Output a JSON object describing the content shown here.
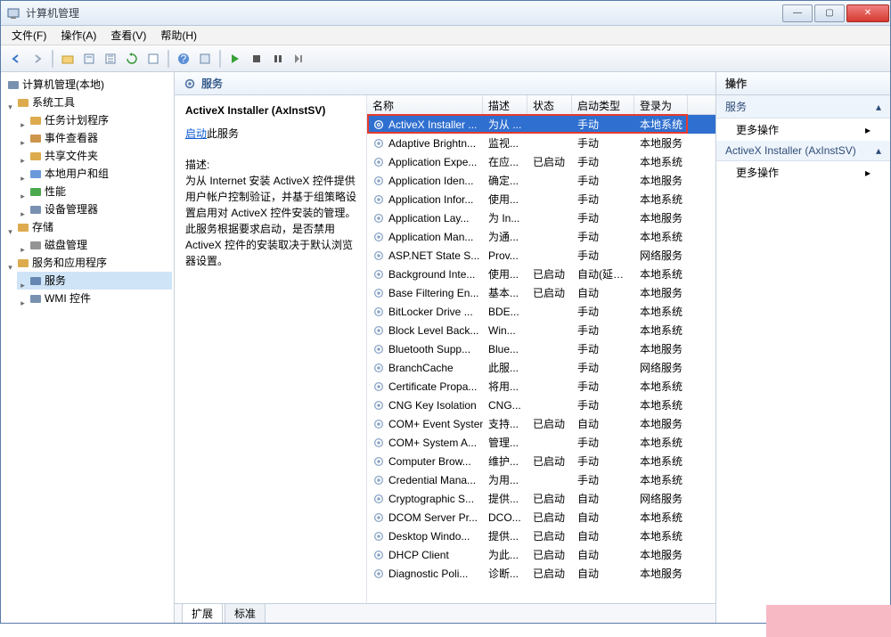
{
  "window": {
    "title": "计算机管理"
  },
  "menu": {
    "file": "文件(F)",
    "action": "操作(A)",
    "view": "查看(V)",
    "help": "帮助(H)"
  },
  "toolbar_icons": [
    "back",
    "forward",
    "sep",
    "up",
    "props",
    "export",
    "refresh",
    "sep2",
    "help",
    "help2",
    "sep3",
    "play",
    "stop",
    "pause",
    "restart"
  ],
  "tree": {
    "root": "计算机管理(本地)",
    "systools": {
      "label": "系统工具",
      "children": [
        {
          "icon": "sched",
          "label": "任务计划程序"
        },
        {
          "icon": "event",
          "label": "事件查看器"
        },
        {
          "icon": "share",
          "label": "共享文件夹"
        },
        {
          "icon": "users",
          "label": "本地用户和组"
        },
        {
          "icon": "perf",
          "label": "性能"
        },
        {
          "icon": "devmgr",
          "label": "设备管理器"
        }
      ]
    },
    "storage": {
      "label": "存储",
      "children": [
        {
          "icon": "disk",
          "label": "磁盘管理"
        }
      ]
    },
    "services": {
      "label": "服务和应用程序",
      "children": [
        {
          "icon": "gear",
          "label": "服务",
          "selected": true
        },
        {
          "icon": "wmi",
          "label": "WMI 控件"
        }
      ]
    }
  },
  "mid": {
    "heading": "服务",
    "selected_name": "ActiveX Installer (AxInstSV)",
    "start_link": "启动",
    "start_suffix": "此服务",
    "desc_label": "描述:",
    "desc_text": "为从 Internet 安装 ActiveX 控件提供用户帐户控制验证，并基于组策略设置启用对 ActiveX 控件安装的管理。此服务根据要求启动，是否禁用 ActiveX 控件的安装取决于默认浏览器设置。"
  },
  "columns": {
    "name": "名称",
    "desc": "描述",
    "status": "状态",
    "startup": "启动类型",
    "logon": "登录为"
  },
  "rows": [
    {
      "n": "ActiveX Installer ...",
      "d": "为从 ...",
      "s": "",
      "t": "手动",
      "l": "本地系统",
      "sel": true
    },
    {
      "n": "Adaptive Brightn...",
      "d": "监视...",
      "s": "",
      "t": "手动",
      "l": "本地服务"
    },
    {
      "n": "Application Expe...",
      "d": "在应...",
      "s": "已启动",
      "t": "手动",
      "l": "本地系统"
    },
    {
      "n": "Application Iden...",
      "d": "确定...",
      "s": "",
      "t": "手动",
      "l": "本地服务"
    },
    {
      "n": "Application Infor...",
      "d": "使用...",
      "s": "",
      "t": "手动",
      "l": "本地系统"
    },
    {
      "n": "Application Lay...",
      "d": "为 In...",
      "s": "",
      "t": "手动",
      "l": "本地服务"
    },
    {
      "n": "Application Man...",
      "d": "为通...",
      "s": "",
      "t": "手动",
      "l": "本地系统"
    },
    {
      "n": "ASP.NET State S...",
      "d": "Prov...",
      "s": "",
      "t": "手动",
      "l": "网络服务"
    },
    {
      "n": "Background Inte...",
      "d": "使用...",
      "s": "已启动",
      "t": "自动(延迟...",
      "l": "本地系统"
    },
    {
      "n": "Base Filtering En...",
      "d": "基本...",
      "s": "已启动",
      "t": "自动",
      "l": "本地服务"
    },
    {
      "n": "BitLocker Drive ...",
      "d": "BDE...",
      "s": "",
      "t": "手动",
      "l": "本地系统"
    },
    {
      "n": "Block Level Back...",
      "d": "Win...",
      "s": "",
      "t": "手动",
      "l": "本地系统"
    },
    {
      "n": "Bluetooth Supp...",
      "d": "Blue...",
      "s": "",
      "t": "手动",
      "l": "本地服务"
    },
    {
      "n": "BranchCache",
      "d": "此服...",
      "s": "",
      "t": "手动",
      "l": "网络服务"
    },
    {
      "n": "Certificate Propa...",
      "d": "将用...",
      "s": "",
      "t": "手动",
      "l": "本地系统"
    },
    {
      "n": "CNG Key Isolation",
      "d": "CNG...",
      "s": "",
      "t": "手动",
      "l": "本地系统"
    },
    {
      "n": "COM+ Event System",
      "d": "支持...",
      "s": "已启动",
      "t": "自动",
      "l": "本地服务"
    },
    {
      "n": "COM+ System A...",
      "d": "管理...",
      "s": "",
      "t": "手动",
      "l": "本地系统"
    },
    {
      "n": "Computer Brow...",
      "d": "维护...",
      "s": "已启动",
      "t": "手动",
      "l": "本地系统"
    },
    {
      "n": "Credential Mana...",
      "d": "为用...",
      "s": "",
      "t": "手动",
      "l": "本地系统"
    },
    {
      "n": "Cryptographic S...",
      "d": "提供...",
      "s": "已启动",
      "t": "自动",
      "l": "网络服务"
    },
    {
      "n": "DCOM Server Pr...",
      "d": "DCO...",
      "s": "已启动",
      "t": "自动",
      "l": "本地系统"
    },
    {
      "n": "Desktop Windo...",
      "d": "提供...",
      "s": "已启动",
      "t": "自动",
      "l": "本地系统"
    },
    {
      "n": "DHCP Client",
      "d": "为此...",
      "s": "已启动",
      "t": "自动",
      "l": "本地服务"
    },
    {
      "n": "Diagnostic Poli...",
      "d": "诊断...",
      "s": "已启动",
      "t": "自动",
      "l": "本地服务"
    }
  ],
  "tabs": {
    "ext": "扩展",
    "std": "标准"
  },
  "actions": {
    "header": "操作",
    "sec1": "服务",
    "link1": "更多操作",
    "sec2": "ActiveX Installer (AxInstSV)",
    "link2": "更多操作"
  }
}
